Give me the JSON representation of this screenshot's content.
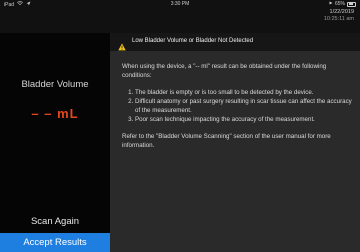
{
  "status_bar": {
    "device": "iPad",
    "time": "3:30 PM",
    "battery": "65%"
  },
  "datetime": {
    "date": "1/22/2019",
    "time": "10:25:11 am"
  },
  "left_panel": {
    "label": "Bladder Volume",
    "value": "– –",
    "unit": "mL",
    "value_color": "#e5461f"
  },
  "buttons": {
    "scan_again": "Scan Again",
    "accept_results": "Accept Results",
    "accent_color": "#1f7fe0"
  },
  "alert": {
    "icon": "warning-icon",
    "title": "Low Bladder Volume or Bladder Not Detected",
    "intro": "When using the device, a \"-- ml\" result can be obtained under the following conditions:",
    "conditions": [
      "The bladder is empty or is too small to be detected by the device.",
      "Difficult anatomy or past surgery resulting in scar tissue can affect the accuracy of the measurement.",
      "Poor scan technique impacting the accuracy of the measurement."
    ],
    "footer": "Refer to the \"Bladder Volume Scanning\" section of the user manual for more information."
  }
}
